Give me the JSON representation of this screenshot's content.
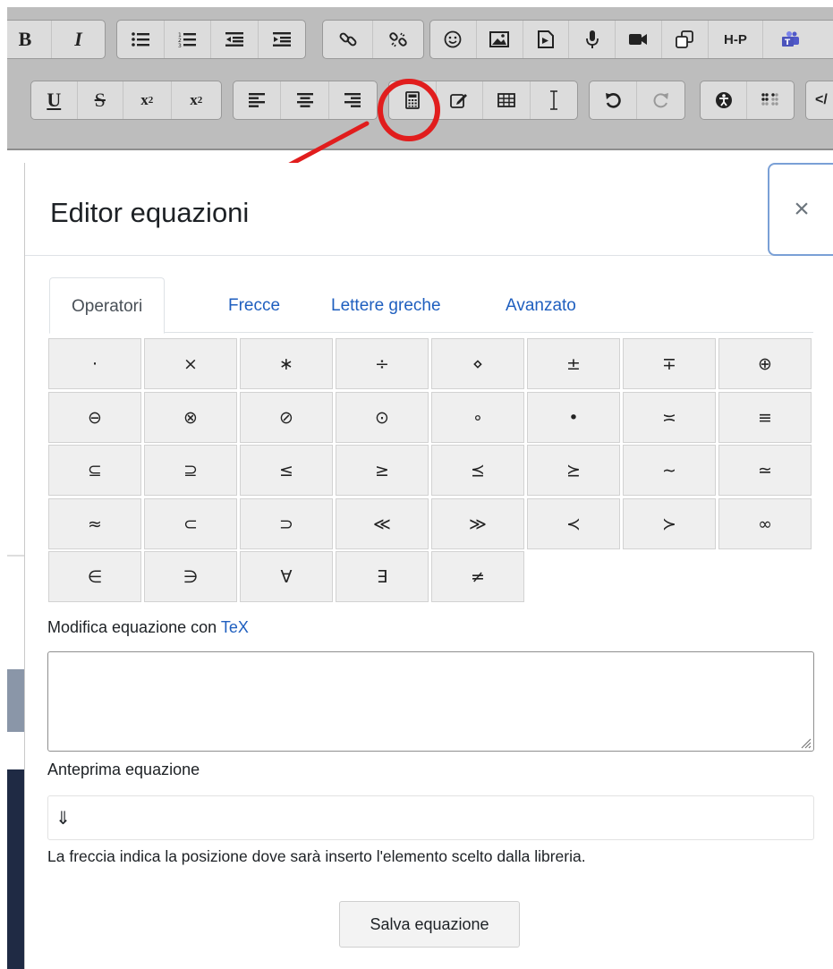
{
  "toolbar": {
    "row1": [
      {
        "group": "format-basic",
        "buttons": [
          {
            "name": "bold-button",
            "label": "B"
          },
          {
            "name": "italic-button",
            "label": "I"
          }
        ]
      },
      {
        "group": "lists",
        "buttons": [
          {
            "name": "unordered-list-button",
            "icon": "list-bullet-icon"
          },
          {
            "name": "ordered-list-button",
            "icon": "list-numbered-icon"
          },
          {
            "name": "outdent-button",
            "icon": "outdent-icon"
          },
          {
            "name": "indent-button",
            "icon": "indent-icon"
          }
        ]
      },
      {
        "group": "links",
        "buttons": [
          {
            "name": "link-button",
            "icon": "link-icon"
          },
          {
            "name": "unlink-button",
            "icon": "unlink-icon"
          }
        ]
      },
      {
        "group": "media",
        "buttons": [
          {
            "name": "emoji-button",
            "icon": "smiley-icon"
          },
          {
            "name": "image-button",
            "icon": "image-icon"
          },
          {
            "name": "media-button",
            "icon": "file-media-icon"
          },
          {
            "name": "record-audio-button",
            "icon": "microphone-icon"
          },
          {
            "name": "record-video-button",
            "icon": "video-camera-icon"
          },
          {
            "name": "copy-button",
            "icon": "copy-icon"
          },
          {
            "name": "h5p-button",
            "label": "H-P"
          },
          {
            "name": "teams-button",
            "icon": "teams-icon"
          }
        ]
      }
    ],
    "row2": [
      {
        "group": "format-more",
        "buttons": [
          {
            "name": "underline-button",
            "label": "U"
          },
          {
            "name": "strikethrough-button",
            "label": "S"
          },
          {
            "name": "subscript-button",
            "label": "x",
            "sub": "2"
          },
          {
            "name": "superscript-button",
            "label": "x",
            "sup": "2"
          }
        ]
      },
      {
        "group": "align",
        "buttons": [
          {
            "name": "align-left-button",
            "icon": "align-left-icon"
          },
          {
            "name": "align-center-button",
            "icon": "align-center-icon"
          },
          {
            "name": "align-right-button",
            "icon": "align-right-icon"
          }
        ]
      },
      {
        "group": "insert",
        "buttons": [
          {
            "name": "equation-editor-button",
            "icon": "calculator-icon"
          },
          {
            "name": "edit-button",
            "icon": "pencil-square-icon"
          },
          {
            "name": "table-button",
            "icon": "table-icon"
          },
          {
            "name": "text-cursor-button",
            "icon": "text-cursor-icon"
          }
        ]
      },
      {
        "group": "history",
        "buttons": [
          {
            "name": "undo-button",
            "icon": "undo-icon"
          },
          {
            "name": "redo-button",
            "icon": "redo-icon"
          }
        ]
      },
      {
        "group": "a11y",
        "buttons": [
          {
            "name": "accessibility-checker-button",
            "icon": "accessibility-icon"
          },
          {
            "name": "screenreader-helper-button",
            "icon": "braille-icon"
          }
        ]
      },
      {
        "group": "html",
        "buttons": [
          {
            "name": "html-button",
            "label": "</"
          }
        ]
      }
    ]
  },
  "annotation": {
    "highlight_color": "#e11d1d"
  },
  "modal": {
    "title": "Editor equazioni",
    "close_label": "×",
    "tabs": [
      {
        "label": "Operatori",
        "active": true
      },
      {
        "label": "Frecce",
        "active": false
      },
      {
        "label": "Lettere greche",
        "active": false
      },
      {
        "label": "Avanzato",
        "active": false
      }
    ],
    "operators": [
      [
        "·",
        "×",
        "∗",
        "÷",
        "⋄",
        "±",
        "∓",
        "⊕"
      ],
      [
        "⊖",
        "⊗",
        "⊘",
        "⊙",
        "∘",
        "•",
        "≍",
        "≡"
      ],
      [
        "⊆",
        "⊇",
        "≤",
        "≥",
        "⪯",
        "⪰",
        "∼",
        "≃"
      ],
      [
        "≈",
        "⊂",
        "⊃",
        "≪",
        "≫",
        "≺",
        "≻",
        "∞"
      ],
      [
        "∈",
        "∋",
        "∀",
        "∃",
        "≠"
      ]
    ],
    "tex_label_prefix": "Modifica equazione con ",
    "tex_link": "TeX",
    "tex_value": "",
    "preview_label": "Anteprima equazione",
    "preview_value": "⇓",
    "help_text": "La freccia indica la posizione dove sarà inserto l'elemento scelto dalla libreria.",
    "save_label": "Salva equazione"
  }
}
